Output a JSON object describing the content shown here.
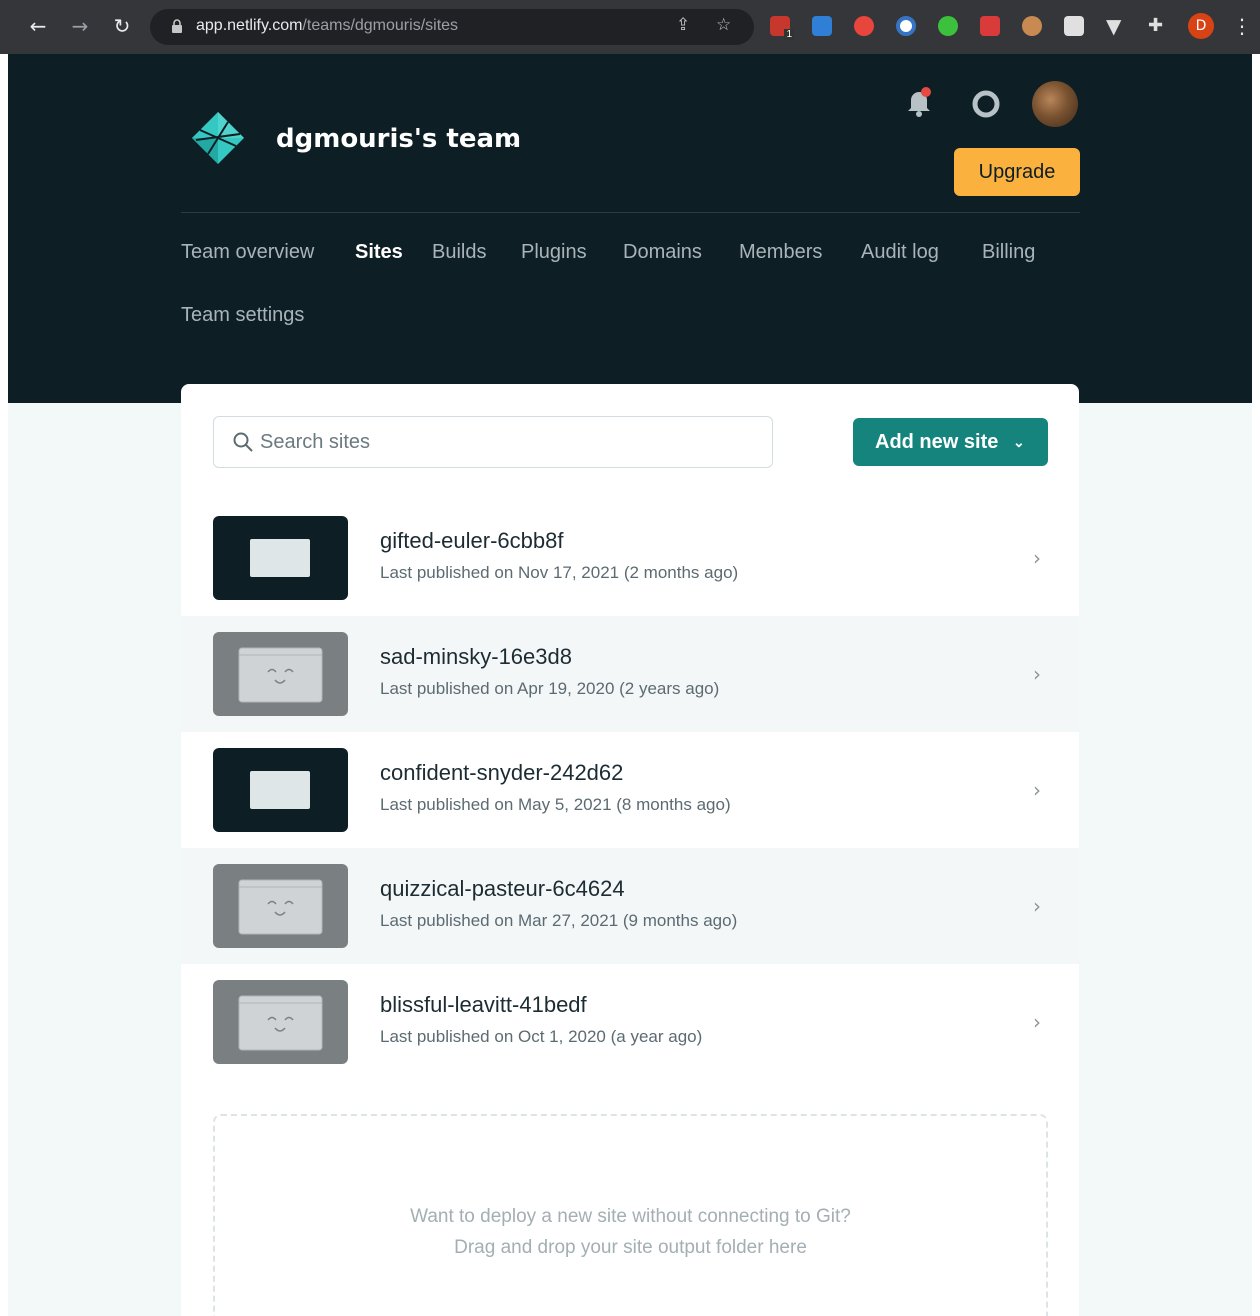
{
  "browser": {
    "url_host": "app.netlify.com",
    "url_path": "/teams/dgmouris/sites",
    "profile_initial": "D",
    "extension_badge": "1"
  },
  "header": {
    "team_name": "dgmouris's team",
    "upgrade_label": "Upgrade"
  },
  "nav": {
    "items": [
      {
        "label": "Team overview"
      },
      {
        "label": "Sites"
      },
      {
        "label": "Builds"
      },
      {
        "label": "Plugins"
      },
      {
        "label": "Domains"
      },
      {
        "label": "Members"
      },
      {
        "label": "Audit log"
      },
      {
        "label": "Billing"
      },
      {
        "label": "Team settings"
      }
    ],
    "active": "Sites"
  },
  "toolbar": {
    "search_placeholder": "Search sites",
    "add_site_label": "Add new site"
  },
  "sites": [
    {
      "name": "gifted-euler-6cbb8f",
      "published": "Last published on Nov 17, 2021 (2 months ago)",
      "thumb": "dark"
    },
    {
      "name": "sad-minsky-16e3d8",
      "published": "Last published on Apr 19, 2020 (2 years ago)",
      "thumb": "placeholder"
    },
    {
      "name": "confident-snyder-242d62",
      "published": "Last published on May 5, 2021 (8 months ago)",
      "thumb": "dark"
    },
    {
      "name": "quizzical-pasteur-6c4624",
      "published": "Last published on Mar 27, 2021 (9 months ago)",
      "thumb": "placeholder"
    },
    {
      "name": "blissful-leavitt-41bedf",
      "published": "Last published on Oct 1, 2020 (a year ago)",
      "thumb": "placeholder"
    }
  ],
  "dropzone": {
    "line1": "Want to deploy a new site without connecting to Git?",
    "line2": "Drag and drop your site output folder here"
  },
  "colors": {
    "header_bg": "#0e1e25",
    "accent_teal": "#15847d",
    "upgrade_yellow": "#fbb13d",
    "notification_red": "#e64a42"
  }
}
